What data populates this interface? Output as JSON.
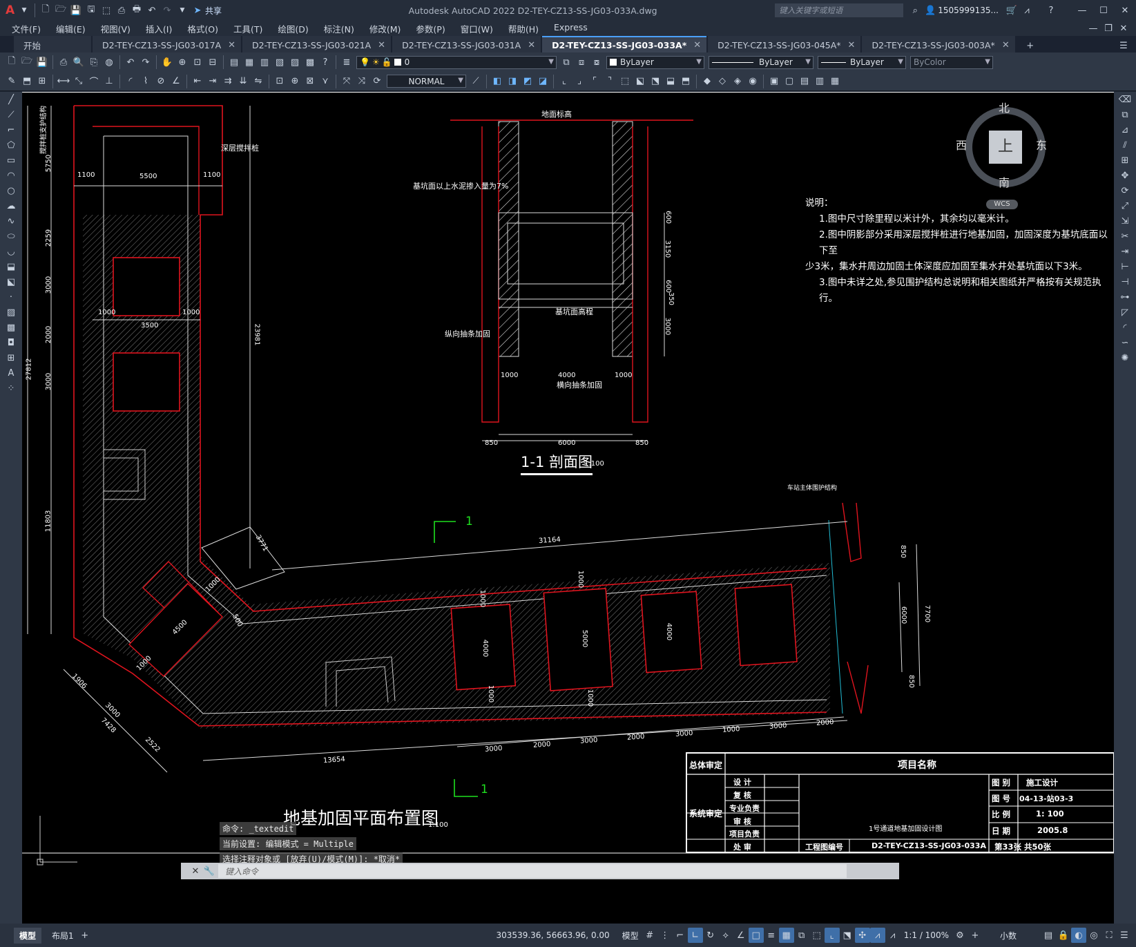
{
  "app": {
    "title": "Autodesk AutoCAD 2022    D2-TEY-CZ13-SS-JG03-033A.dwg",
    "share_label": "共享",
    "search_placeholder": "键入关键字或短语",
    "user": "1505999135...",
    "app_logo": "A"
  },
  "menu": [
    "文件(F)",
    "编辑(E)",
    "视图(V)",
    "插入(I)",
    "格式(O)",
    "工具(T)",
    "绘图(D)",
    "标注(N)",
    "修改(M)",
    "参数(P)",
    "窗口(W)",
    "帮助(H)",
    "Express"
  ],
  "tabs": [
    {
      "label": "开始",
      "active": false
    },
    {
      "label": "D2-TEY-CZ13-SS-JG03-017A",
      "active": false
    },
    {
      "label": "D2-TEY-CZ13-SS-JG03-021A",
      "active": false
    },
    {
      "label": "D2-TEY-CZ13-SS-JG03-031A",
      "active": false
    },
    {
      "label": "D2-TEY-CZ13-SS-JG03-033A*",
      "active": true
    },
    {
      "label": "D2-TEY-CZ13-SS-JG03-045A*",
      "active": false
    },
    {
      "label": "D2-TEY-CZ13-SS-JG03-003A*",
      "active": false
    }
  ],
  "toolbar": {
    "layer": "0",
    "color": "ByLayer",
    "linetype": "ByLayer",
    "lineweight": "ByLayer",
    "plotstyle": "ByColor",
    "dimstyle": "NORMAL"
  },
  "viewcube": {
    "north": "北",
    "south": "南",
    "east": "东",
    "west": "西",
    "top": "上",
    "wcs": "WCS"
  },
  "drawing": {
    "section_title": "1-1  剖面图",
    "section_scale": "1:100",
    "plan_title": "地基加固平面布置图",
    "plan_scale": "1:100",
    "section_mark": "1",
    "notes_title": "说明：",
    "notes": [
      "1.图中尺寸除里程以米计外，其余均以毫米计。",
      "2.图中阴影部分采用深层搅拌桩进行地基加固，加固深度为基坑底面以下至",
      "少3米，集水井周边加固土体深度应加固至集水井处基坑面以下3米。",
      "3.图中未详之处,参见围护结构总说明和相关图纸并严格按有关规范执行。"
    ],
    "section_labels": {
      "ground": "地面标高",
      "cement": "基坑面以上水泥掺入量为7%",
      "pit_bottom": "基坑面高程",
      "long_strip": "纵向抽条加固",
      "trans_strip": "横向抽条加固"
    },
    "plan_labels": {
      "deep_pile": "深层搅拌桩",
      "station_struct": "车站主体围护结构",
      "retaining": "搅拌桩支护结构"
    },
    "section_dims": {
      "h600a": "600",
      "h3150": "3150",
      "h600b": "600",
      "h350": "350",
      "h3000": "3000",
      "w1000a": "1000",
      "w4000": "4000",
      "w1000b": "1000",
      "w850a": "850",
      "w6000": "6000",
      "w850b": "850"
    },
    "plan_dims": {
      "d5750": "5750",
      "d1100a": "1100",
      "d5500": "5500",
      "d1100b": "1100",
      "d2259": "2259",
      "d3000a": "3000",
      "d1000a": "1000",
      "d3500": "3500",
      "d1000b": "1000",
      "d2000a": "2000",
      "d3000b": "3000",
      "d27812": "27812",
      "d23981": "23981",
      "d11803": "11803",
      "d3771": "3771",
      "d1000c": "1000",
      "d500": "500",
      "d4500": "4500",
      "d1000d": "1000",
      "d1906": "1906",
      "d3000c": "3000",
      "d7428": "7428",
      "d2522": "2522",
      "d31164": "31164",
      "d1000e": "1000",
      "d4000a": "4000",
      "d1000f": "1000",
      "d1000g": "1000",
      "d5000": "5000",
      "d1000h": "1000",
      "d4000b": "4000",
      "d850a": "850",
      "d6000": "6000",
      "d7700": "7700",
      "d850b": "850",
      "b3000a": "3000",
      "b2000a": "2000",
      "b3000b": "3000",
      "b2000b": "2000",
      "b3000c": "3000",
      "b1000": "1000",
      "b3000d": "3000",
      "b2000c": "2000",
      "d13654": "13654"
    },
    "title_block": {
      "overall_review": "总体审定",
      "project_name": "项目名称",
      "system_review": "系统审定",
      "design": "设 计",
      "check": "复 核",
      "specialty": "专业负责",
      "review": "审 核",
      "project_lead": "项目负责",
      "approve": "处 审",
      "drawing_name": "1号通道地基加固设计图",
      "drawing_code_label": "工程图编号",
      "drawing_code": "D2-TEY-CZ13-SS-JG03-033A",
      "category_label": "图 别",
      "category": "施工设计",
      "number_label": "图 号",
      "number": "04-13-站03-3",
      "scale_label": "比 例",
      "scale": "1: 100",
      "date_label": "日 期",
      "date": "2005.8",
      "sheet": "第33张  共50张"
    }
  },
  "command": {
    "history": [
      "命令: _textedit",
      "当前设置: 编辑模式 = Multiple",
      "选择注释对象或 [放弃(U)/模式(M)]: *取消*"
    ],
    "placeholder": "键入命令"
  },
  "status": {
    "layout_tabs": [
      "模型",
      "布局1"
    ],
    "coords": "303539.36, 56663.96, 0.00",
    "space": "模型",
    "annoscale": "1:1 / 100%",
    "units": "小数"
  }
}
